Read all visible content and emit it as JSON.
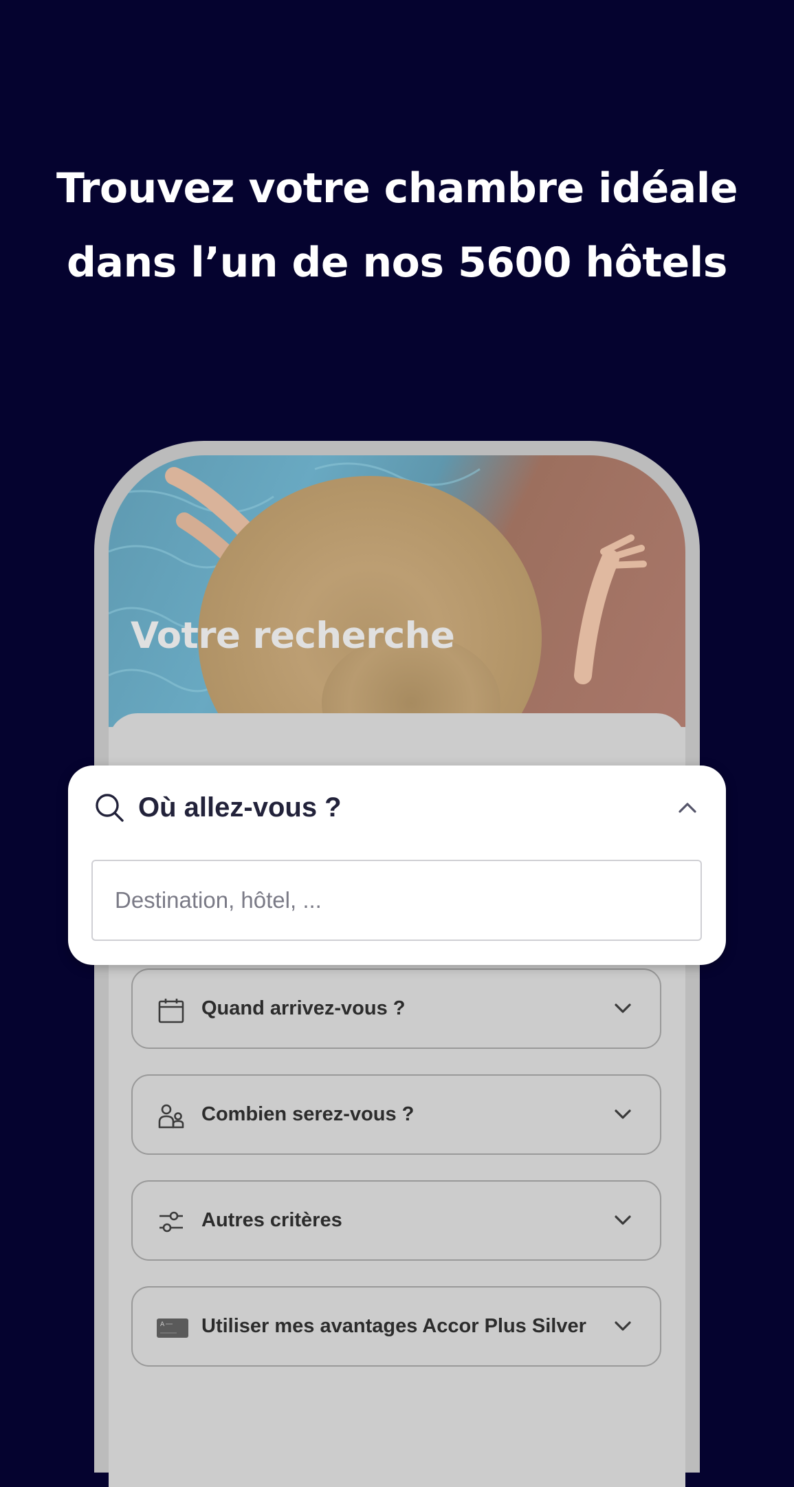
{
  "headline": {
    "line1": "Trouvez votre chambre idéale",
    "line2": "dans l’un de nos 5600 hôtels"
  },
  "phone": {
    "hero_title": "Votre recherche"
  },
  "search": {
    "title": "Où allez-vous ?",
    "placeholder": "Destination, hôtel, ...",
    "value": ""
  },
  "options": [
    {
      "label": "Quand arrivez-vous ?",
      "icon": "calendar-icon"
    },
    {
      "label": "Combien serez-vous ?",
      "icon": "people-icon"
    },
    {
      "label": "Autres critères",
      "icon": "filter-sliders-icon"
    },
    {
      "label": "Utiliser mes avantages Accor Plus Silver",
      "icon": "membership-card-icon"
    }
  ],
  "colors": {
    "background": "#05032f",
    "text_dark": "#22223a",
    "overlay_gray": "#cccccc"
  }
}
